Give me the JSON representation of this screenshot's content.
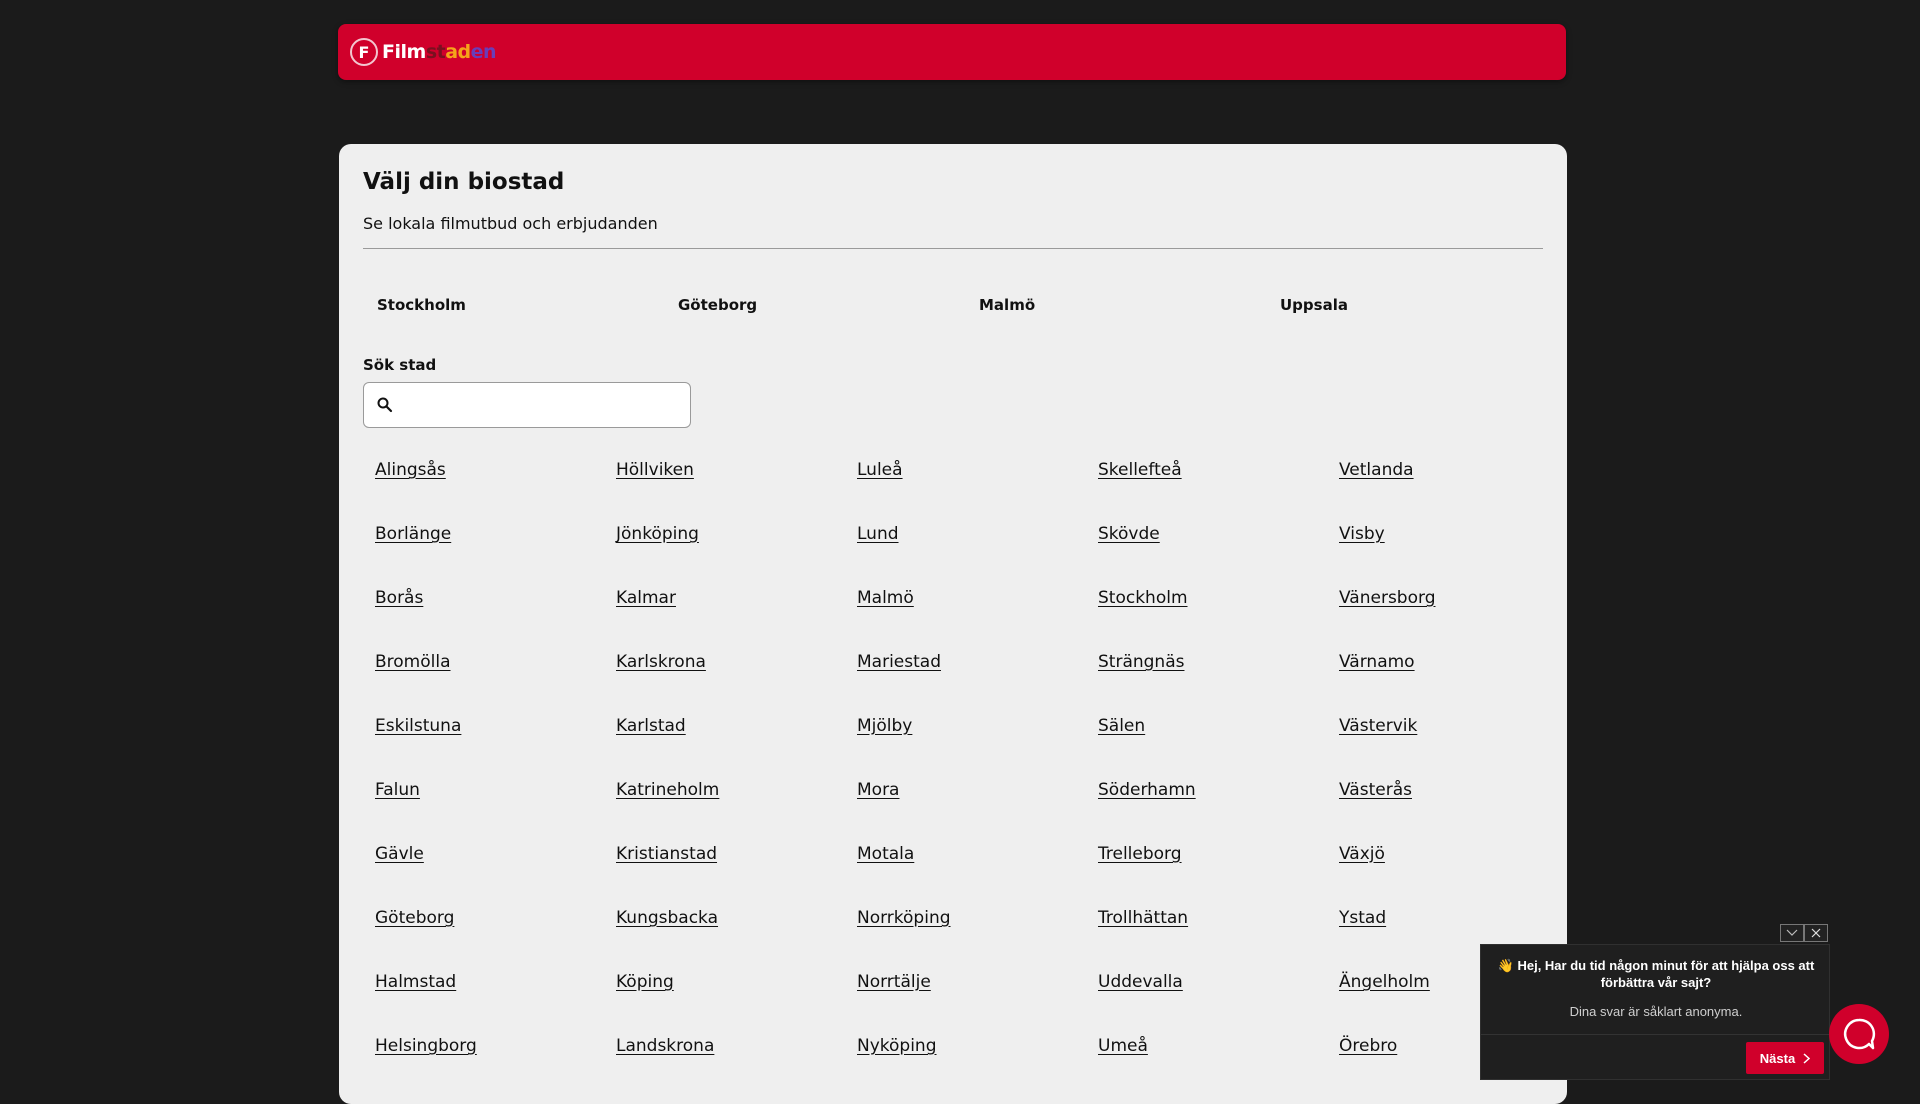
{
  "header": {
    "logo_mark": "F",
    "logo_text_parts": [
      "Film",
      "st",
      "ad",
      "en"
    ]
  },
  "page": {
    "title": "Välj din biostad",
    "subtitle": "Se lokala filmutbud och erbjudanden"
  },
  "quick_links": [
    "Stockholm",
    "Göteborg",
    "Malmö",
    "Uppsala"
  ],
  "search": {
    "label": "Sök stad",
    "value": "",
    "placeholder": ""
  },
  "cities": [
    "Alingsås",
    "Borlänge",
    "Borås",
    "Bromölla",
    "Eskilstuna",
    "Falun",
    "Gävle",
    "Göteborg",
    "Halmstad",
    "Helsingborg",
    "Höllviken",
    "Jönköping",
    "Kalmar",
    "Karlskrona",
    "Karlstad",
    "Katrineholm",
    "Kristianstad",
    "Kungsbacka",
    "Köping",
    "Landskrona",
    "Luleå",
    "Lund",
    "Malmö",
    "Mariestad",
    "Mjölby",
    "Mora",
    "Motala",
    "Norrköping",
    "Norrtälje",
    "Nyköping",
    "Skellefteå",
    "Skövde",
    "Stockholm",
    "Strängnäs",
    "Sälen",
    "Söderhamn",
    "Trelleborg",
    "Trollhättan",
    "Uddevalla",
    "Umeå",
    "Vetlanda",
    "Visby",
    "Vänersborg",
    "Värnamo",
    "Västervik",
    "Västerås",
    "Växjö",
    "Ystad",
    "Ängelholm",
    "Örebro"
  ],
  "survey": {
    "question": "👋 Hej, Har du tid någon minut för att hjälpa oss att förbättra vår sajt?",
    "note": "Dina svar är såklart anonyma.",
    "next_label": "Nästa"
  },
  "colors": {
    "brand_red": "#d0002b",
    "background": "#1b1b1b",
    "card": "#efefef"
  }
}
